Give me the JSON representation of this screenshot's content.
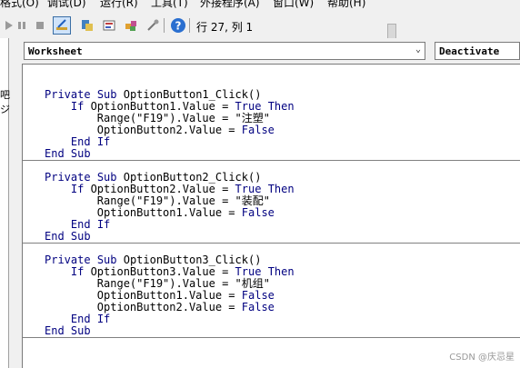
{
  "menubar": {
    "items": [
      "格式(O)",
      "调试(D)",
      "运行(R)",
      "工具(T)",
      "外接程序(A)",
      "窗口(W)",
      "帮助(H)"
    ]
  },
  "toolbar": {
    "status": "行 27, 列 1"
  },
  "combos": {
    "object": "Worksheet",
    "procedure": "Deactivate"
  },
  "leftpane": {
    "labels": [
      "吧",
      "ジ"
    ]
  },
  "code": {
    "procedures": [
      {
        "lines": [
          "Private Sub OptionButton1_Click()",
          "    If OptionButton1.Value = True Then",
          "        Range(\"F19\").Value = \"注塑\"",
          "        OptionButton2.Value = False",
          "    End If",
          "End Sub"
        ]
      },
      {
        "lines": [
          "Private Sub OptionButton2_Click()",
          "    If OptionButton2.Value = True Then",
          "        Range(\"F19\").Value = \"装配\"",
          "        OptionButton1.Value = False",
          "    End If",
          "End Sub"
        ]
      },
      {
        "lines": [
          "Private Sub OptionButton3_Click()",
          "    If OptionButton3.Value = True Then",
          "        Range(\"F19\").Value = \"机组\"",
          "        OptionButton1.Value = False",
          "        OptionButton2.Value = False",
          "    End If",
          "End Sub"
        ]
      }
    ]
  },
  "watermark": "CSDN @庆忌星"
}
